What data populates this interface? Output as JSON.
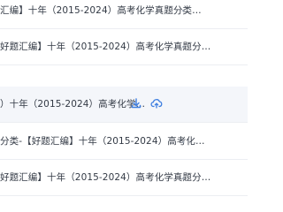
{
  "files": [
    {
      "title": "汇编】十年（2015-2024）高考化学真题分类…",
      "hovered": false
    },
    {
      "title": "好题汇编】十年（2015-2024）高考化学真题分…",
      "hovered": false
    },
    {
      "title": "）十年（2015-2024）高考化学…",
      "hovered": true,
      "actions": [
        "download-icon",
        "cloud-upload-icon"
      ]
    },
    {
      "title": "分类-【好题汇编】十年（2015-2024）高考化…",
      "hovered": false
    },
    {
      "title": "好题汇编】十年（2015-2024）高考化学真题分…",
      "hovered": false
    }
  ],
  "colors": {
    "accent": "#3f7fe0",
    "text": "#333a45",
    "divider": "#eceef2",
    "hover_bg": "#f4f6fa"
  }
}
